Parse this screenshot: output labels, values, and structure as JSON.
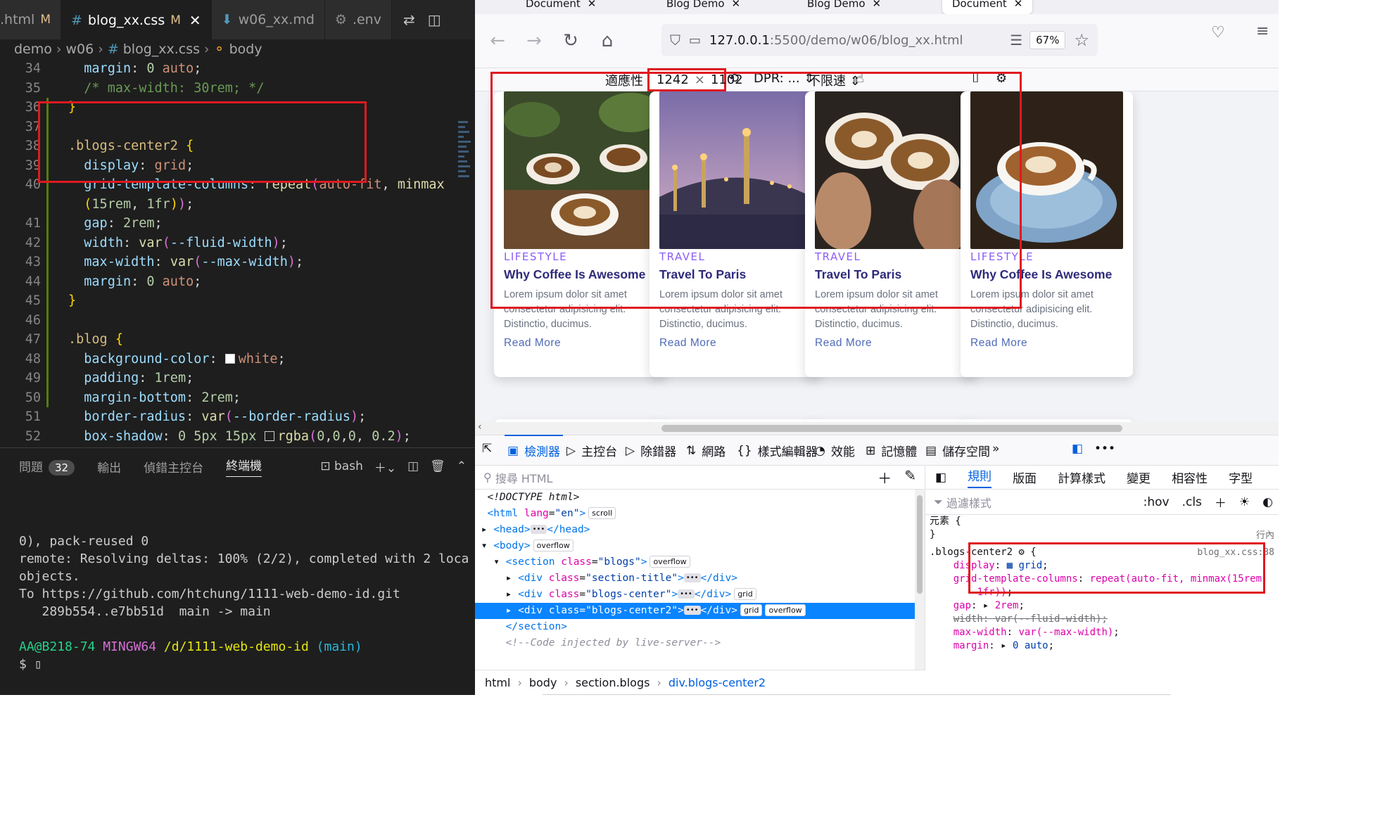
{
  "vscode": {
    "tabs": [
      {
        "label": ".html",
        "modified": "M"
      },
      {
        "label": "blog_xx.css",
        "modified": "M",
        "close": "✕"
      },
      {
        "label": "w06_xx.md"
      },
      {
        "label": ".env"
      }
    ],
    "breadcrumb": [
      "demo",
      "w06",
      "blog_xx.css",
      "body"
    ],
    "code_lines": [
      {
        "n": "34",
        "html": "  <span class='t-prop'>margin</span>: <span class='t-num'>0</span> <span class='t-val'>auto</span>;"
      },
      {
        "n": "35",
        "html": "  <span class='t-cm'>/* max-width: 30rem; */</span>"
      },
      {
        "n": "36",
        "html": "<span class='t-br'>}</span>"
      },
      {
        "n": "37",
        "html": ""
      },
      {
        "n": "38",
        "html": "<span class='t-sel'>.blogs-center2</span> <span class='t-br'>{</span>"
      },
      {
        "n": "39",
        "html": "  <span class='t-prop'>display</span>: <span class='t-val'>grid</span>;"
      },
      {
        "n": "40",
        "html": "  <span class='t-prop'>grid-template-columns</span>: <span class='t-fn'>repeat</span><span class='t-br2'>(</span><span class='t-val'>auto-fit</span>, <span class='t-fn'>minmax</span>"
      },
      {
        "n": "",
        "html": "  <span class='t-br'>(</span><span class='t-num'>15rem</span>, <span class='t-num'>1fr</span><span class='t-br'>)</span><span class='t-br2'>)</span>;"
      },
      {
        "n": "41",
        "html": "  <span class='t-prop'>gap</span>: <span class='t-num'>2rem</span>;"
      },
      {
        "n": "42",
        "html": "  <span class='t-prop'>width</span>: <span class='t-fn'>var</span><span class='t-br2'>(</span><span class='t-prop'>--fluid-width</span><span class='t-br2'>)</span>;"
      },
      {
        "n": "43",
        "html": "  <span class='t-prop'>max-width</span>: <span class='t-fn'>var</span><span class='t-br2'>(</span><span class='t-prop'>--max-width</span><span class='t-br2'>)</span>;"
      },
      {
        "n": "44",
        "html": "  <span class='t-prop'>margin</span>: <span class='t-num'>0</span> <span class='t-val'>auto</span>;"
      },
      {
        "n": "45",
        "html": "<span class='t-br'>}</span>"
      },
      {
        "n": "46",
        "html": ""
      },
      {
        "n": "47",
        "html": "<span class='t-sel'>.blog</span> <span class='t-br'>{</span>"
      },
      {
        "n": "48",
        "html": "  <span class='t-prop'>background-color</span>: <span class='swatch' style='background:#ffffff'></span><span class='t-val'>white</span>;"
      },
      {
        "n": "49",
        "html": "  <span class='t-prop'>padding</span>: <span class='t-num'>1rem</span>;"
      },
      {
        "n": "50",
        "html": "  <span class='t-prop'>margin-bottom</span>: <span class='t-num'>2rem</span>;"
      },
      {
        "n": "51",
        "html": "  <span class='t-prop'>border-radius</span>: <span class='t-fn'>var</span><span class='t-br2'>(</span><span class='t-prop'>--border-radius</span><span class='t-br2'>)</span>;"
      },
      {
        "n": "52",
        "html": "  <span class='t-prop'>box-shadow</span>: <span class='t-num'>0</span> <span class='t-num'>5px</span> <span class='t-num'>15px</span> <span class='swatch' style='background:#1e1e1e'></span><span class='t-fn'>rgba</span><span class='t-br2'>(</span><span class='t-num'>0</span>,<span class='t-num'>0</span>,<span class='t-num'>0</span>, <span class='t-num'>0.2</span><span class='t-br2'>)</span>;"
      }
    ],
    "panel": {
      "tabs": {
        "problems": "問題",
        "problems_count": "32",
        "output": "輸出",
        "debug_console": "偵錯主控台",
        "terminal": "終端機"
      },
      "shell": "bash"
    },
    "terminal_lines": [
      {
        "html": "0), pack-reused 0"
      },
      {
        "html": "remote: Resolving deltas: 100% (2/2), completed with 2 loca"
      },
      {
        "html": "objects."
      },
      {
        "html": "To https://github.com/htchung/1111-web-demo-id.git"
      },
      {
        "html": "   289b554..e7bb51d  main -> main"
      },
      {
        "html": ""
      },
      {
        "html": "<span class='usr'>AA@B218-74</span> <span class='host'>MINGW64</span> <span class='path'>/d/1111-web-demo-id</span> <span class='branch'>(main)</span>"
      },
      {
        "html": "$ ▯"
      }
    ]
  },
  "firefox": {
    "tabs": [
      "Document",
      "Blog Demo",
      "Blog Demo",
      "Document"
    ],
    "url_host": "127.0.0.1",
    "url_rest": ":5500/demo/w06/blog_xx.html",
    "zoom": "67%",
    "rdm": {
      "device": "適應性",
      "width": "1242",
      "times": "×",
      "height": "1102",
      "dpr": "DPR: ...",
      "throttle": "不限速"
    },
    "blogs": [
      {
        "category": "LIFESTYLE",
        "title": "Why Coffee Is Awesome",
        "desc": "Lorem ipsum dolor sit amet consectetur adipisicing elit. Distinctio, ducimus.",
        "link": "Read More",
        "image": "coffee-cups"
      },
      {
        "category": "TRAVEL",
        "title": "Travel To Paris",
        "desc": "Lorem ipsum dolor sit amet consectetur adipisicing elit. Distinctio, ducimus.",
        "link": "Read More",
        "image": "paris-bridge"
      },
      {
        "category": "TRAVEL",
        "title": "Travel To Paris",
        "desc": "Lorem ipsum dolor sit amet consectetur adipisicing elit. Distinctio, ducimus.",
        "link": "Read More",
        "image": "coffee-hands"
      },
      {
        "category": "LIFESTYLE",
        "title": "Why Coffee Is Awesome",
        "desc": "Lorem ipsum dolor sit amet consectetur adipisicing elit. Distinctio, ducimus.",
        "link": "Read More",
        "image": "coffee-saucer"
      }
    ],
    "devtools": {
      "tabs": {
        "inspector": "檢測器",
        "console": "主控台",
        "debugger": "除錯器",
        "network": "網路",
        "style_editor": "樣式編輯器",
        "performance": "效能",
        "memory": "記憶體",
        "storage": "儲存空間"
      },
      "search_placeholder": "搜尋 HTML",
      "tree": [
        {
          "html": "  <i>&lt;!DOCTYPE html&gt;</i>"
        },
        {
          "html": "  <span class='tag'>&lt;html</span> <span class='attr'>lang</span>=<span class='aval'>\"en\"</span><span class='tag'>&gt;</span><span class='pill'>scroll</span>"
        },
        {
          "html": " ▸ <span class='tag'>&lt;head&gt;</span><span class='ellip'>•••</span><span class='tag'>&lt;/head&gt;</span>"
        },
        {
          "html": " ▾ <span class='tag'>&lt;body&gt;</span><span class='pill'>overflow</span>"
        },
        {
          "html": "   ▾ <span class='tag'>&lt;section</span> <span class='attr'>class</span>=<span class='aval'>\"blogs\"</span><span class='tag'>&gt;</span><span class='pill'>overflow</span>"
        },
        {
          "html": "     ▸ <span class='tag'>&lt;div</span> <span class='attr'>class</span>=<span class='aval'>\"section-title\"</span><span class='tag'>&gt;</span><span class='ellip'>•••</span><span class='tag'>&lt;/div&gt;</span>"
        },
        {
          "html": "     ▸ <span class='tag'>&lt;div</span> <span class='attr'>class</span>=<span class='aval'>\"blogs-center\"</span><span class='tag'>&gt;</span><span class='ellip'>•••</span><span class='tag'>&lt;/div&gt;</span><span class='pill'>grid</span>"
        },
        {
          "html": "     ▸ <span class='tag'>&lt;div</span> <span class='attr'>class</span>=<span class='aval'>\"blogs-center2\"</span><span class='tag'>&gt;</span><span class='ellip'>•••</span><span class='tag'>&lt;/div&gt;</span><span class='pill'>grid</span><span class='pill'>overflow</span>",
          "selected": true
        },
        {
          "html": "     <span class='tag'>&lt;/section&gt;</span>"
        },
        {
          "html": "     <span class='comment'>&lt;!--Code injected by live-server--&gt;</span>"
        }
      ],
      "breadcrumbs": {
        "a": "html",
        "b": "body",
        "c": "section.blogs",
        "d": "div.blogs-center2"
      },
      "rules_tabs": {
        "rules": "規則",
        "layout": "版面",
        "computed": "計算樣式",
        "changes": "變更",
        "compat": "相容性",
        "fonts": "字型"
      },
      "filter_placeholder": "過濾樣式",
      "hov": ":hov",
      "cls": ".cls",
      "inline": "行內",
      "rules": [
        {
          "html": "元素 {"
        },
        {
          "html": "}"
        },
        {
          "html": ".blogs-center2 ⚙ {",
          "src": "blog_xx.css:38"
        },
        {
          "html": "    <span class='rprop'>display</span>: <span class='rval'>▦ grid</span>;"
        },
        {
          "html": "    <span class='rprop'>grid-template-columns</span>: <span class='rval str'>repeat(auto-fit, minmax(15rem,</span>"
        },
        {
          "html": "        <span class='rval str'>1fr))</span>;"
        },
        {
          "html": "    <span class='rprop'>gap</span>: ▸ <span class='rval str'>2rem</span>;"
        },
        {
          "html": "    <span class='strike'>width: var(--fluid-width);</span>"
        },
        {
          "html": "    <span class='rprop'>max-width</span>: <span class='rval str'>var(--max-width)</span>;"
        },
        {
          "html": "    <span class='rprop'>margin</span>: ▸ <span class='rval'>0 auto</span>;"
        }
      ]
    }
  }
}
